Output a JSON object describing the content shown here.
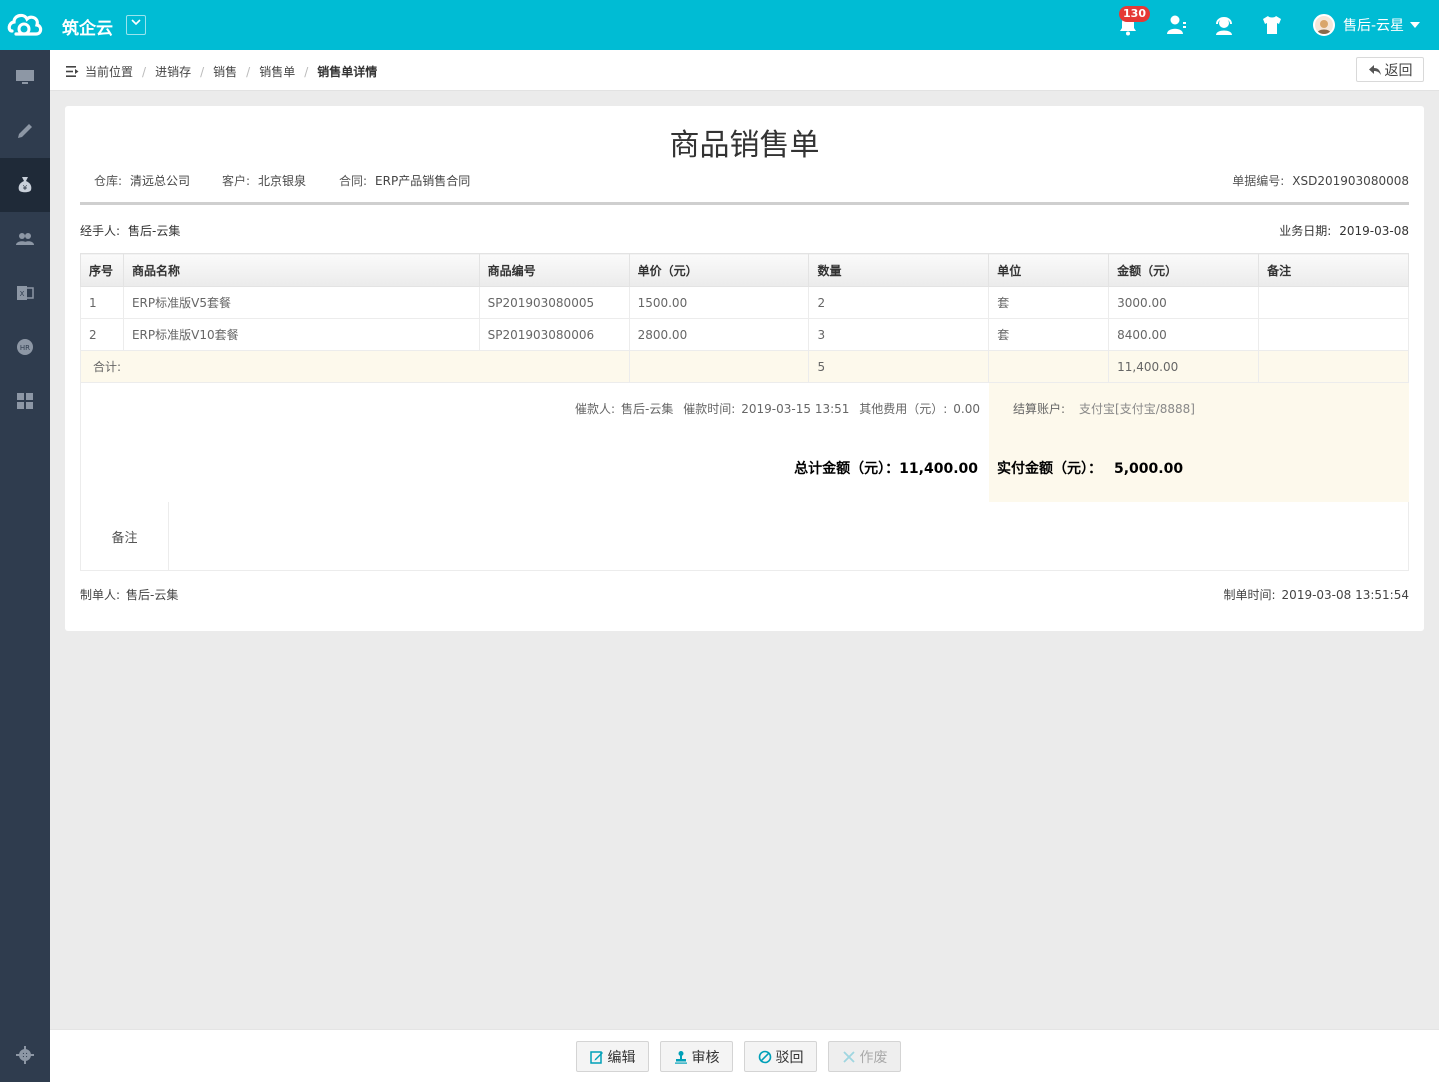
{
  "app": {
    "name": "筑企云",
    "notification_count": "130",
    "user_name": "售后-云星"
  },
  "breadcrumb": {
    "label": "当前位置",
    "items": [
      "进销存",
      "销售",
      "销售单"
    ],
    "current": "销售单详情",
    "back_label": "返回"
  },
  "document": {
    "title": "商品销售单",
    "warehouse_label": "仓库:",
    "warehouse": "清远总公司",
    "customer_label": "客户:",
    "customer": "北京银泉",
    "contract_label": "合同:",
    "contract": "ERP产品销售合同",
    "doc_no_label": "单据编号:",
    "doc_no": "XSD201903080008",
    "handler_label": "经手人:",
    "handler": "售后-云集",
    "biz_date_label": "业务日期:",
    "biz_date": "2019-03-08"
  },
  "table": {
    "headers": [
      "序号",
      "商品名称",
      "商品编号",
      "单价（元）",
      "数量",
      "单位",
      "金额（元）",
      "备注"
    ],
    "rows": [
      [
        "1",
        "ERP标准版V5套餐",
        "SP201903080005",
        "1500.00",
        "2",
        "套",
        "3000.00",
        ""
      ],
      [
        "2",
        "ERP标准版V10套餐",
        "SP201903080006",
        "2800.00",
        "3",
        "套",
        "8400.00",
        ""
      ]
    ],
    "sum_label": "合计:",
    "sum_qty": "5",
    "sum_amount": "11,400.00"
  },
  "payment": {
    "collector_label": "催款人:",
    "collector": "售后-云集",
    "collect_time_label": "催款时间:",
    "collect_time": "2019-03-15 13:51",
    "other_fee_label": "其他费用（元）:",
    "other_fee": "0.00",
    "account_label": "结算账户:",
    "account": "支付宝[支付宝/8888]",
    "total_label": "总计金额（元）：",
    "total": "11,400.00",
    "paid_label": "实付金额（元）：",
    "paid": "5,000.00"
  },
  "remarks": {
    "label": "备注",
    "value": ""
  },
  "footer": {
    "creator_label": "制单人:",
    "creator": "售后-云集",
    "created_time_label": "制单时间:",
    "created_time": "2019-03-08 13:51:54"
  },
  "actions": {
    "edit": "编辑",
    "audit": "审核",
    "reject": "驳回",
    "void": "作废"
  },
  "colors": {
    "topbar": "#00bcd4",
    "sidebar": "#2f3c4e",
    "badge": "#e53935",
    "summary_bg": "#fdf9ec"
  },
  "icons": {
    "sidebar": [
      "monitor-icon",
      "pencil-icon",
      "money-bag-icon",
      "users-icon",
      "excel-icon",
      "hr-icon",
      "grid-icon",
      "gear-icon"
    ],
    "topbar": [
      "bell-icon",
      "contacts-icon",
      "support-icon",
      "shirt-icon"
    ]
  }
}
